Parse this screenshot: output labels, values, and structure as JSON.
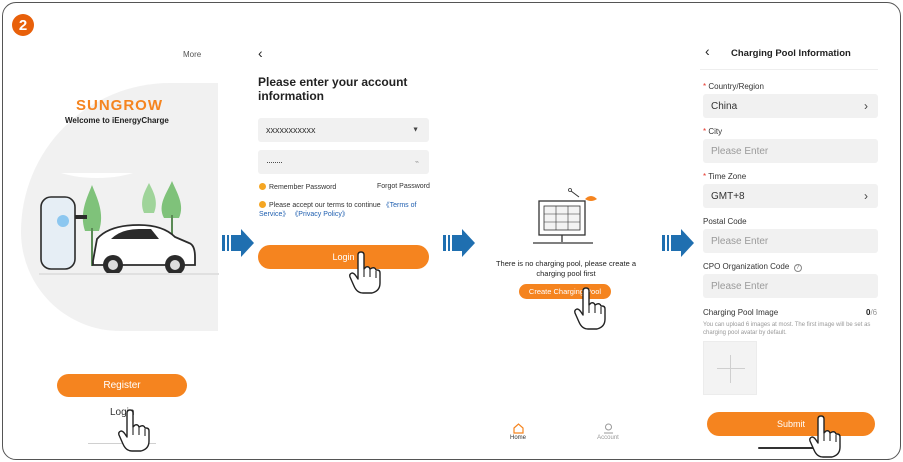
{
  "step": {
    "number": "2"
  },
  "panel1": {
    "more_label": "More",
    "brand": "SUNGROW",
    "welcome": "Welcome to iEnergyCharge",
    "register_label": "Register",
    "login_label": "Login"
  },
  "panel2": {
    "back_icon": "chevron-left-icon",
    "title": "Please enter your account information",
    "account_value": "xxxxxxxxxxx",
    "password_value": "········",
    "remember_label": "Remember Password",
    "forgot_label": "Forgot Password",
    "terms_prefix": "Please accept our terms to continue",
    "terms_link": "《Terms of Service》",
    "privacy_link": "《Privacy Policy》",
    "login_label": "Login"
  },
  "panel3": {
    "empty_message": "There is no charging pool, please create a charging pool first",
    "create_label": "Create Charging Pool",
    "nav": [
      {
        "label": "Home",
        "icon": "home-icon"
      },
      {
        "label": "Account",
        "icon": "account-icon"
      }
    ]
  },
  "panel4": {
    "title": "Charging Pool Information",
    "country_label": "Country/Region",
    "country_value": "China",
    "city_label": "City",
    "city_placeholder": "Please Enter",
    "timezone_label": "Time Zone",
    "timezone_value": "GMT+8",
    "postal_label": "Postal Code",
    "postal_placeholder": "Please Enter",
    "cpo_label": "CPO Organization Code",
    "cpo_placeholder": "Please Enter",
    "image_label": "Charging Pool Image",
    "image_count_current": "0",
    "image_count_max": "/6",
    "image_hint": "You can upload 6 images at most. The first image will be set as charging pool avatar by default.",
    "submit_label": "Submit"
  },
  "colors": {
    "accent": "#f5841f",
    "arrow": "#1f6fb0",
    "required": "#e5362c"
  }
}
